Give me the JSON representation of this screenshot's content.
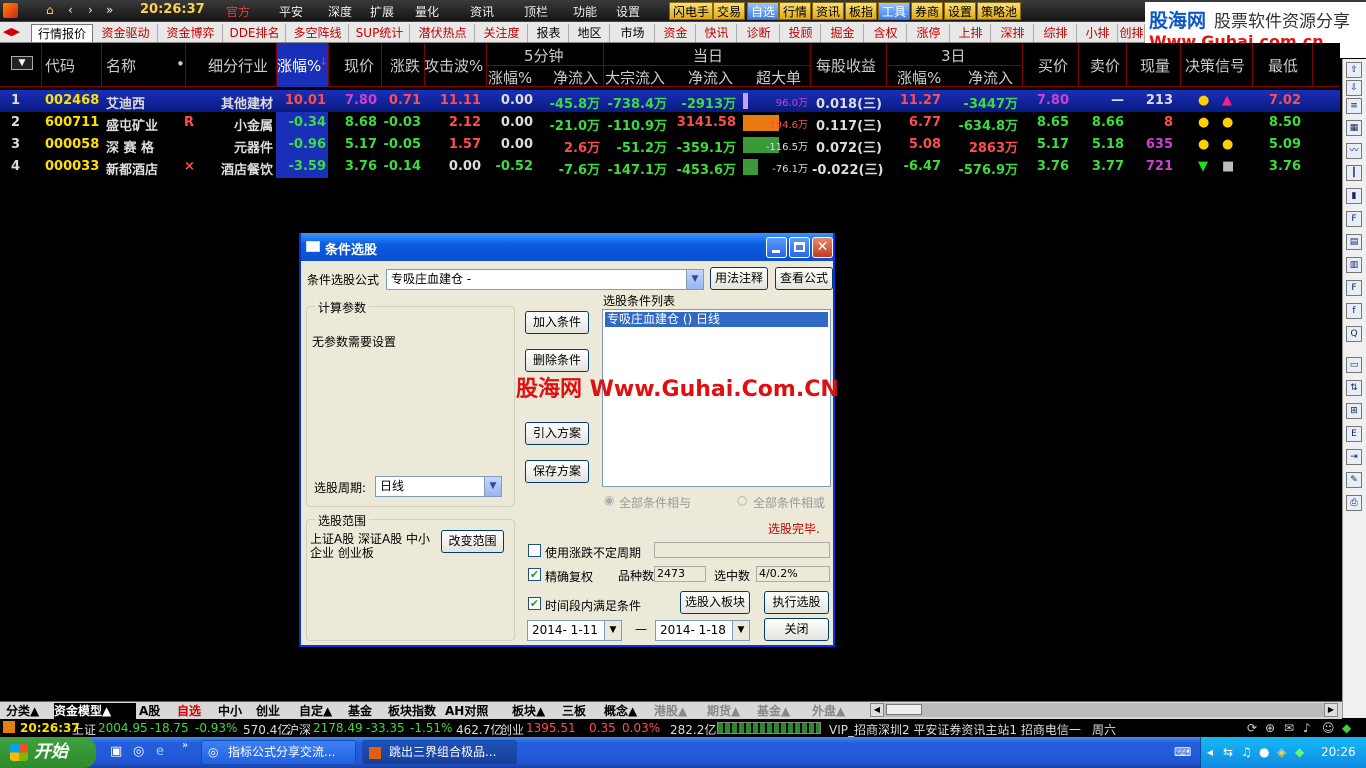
{
  "top_menu": {
    "time": "20:26:37",
    "items": [
      "官方",
      "平安",
      "深度",
      "扩展",
      "量化",
      "资讯",
      "顶栏",
      "功能",
      "设置"
    ],
    "highlight_buttons": [
      "闪电手",
      "交易",
      "自选",
      "行情",
      "资讯",
      "板指",
      "工具",
      "券商",
      "设置",
      "策略池"
    ]
  },
  "watermark": {
    "brand": "股海网",
    "slogan": "股票软件资源分享",
    "url": "Www.Guhai.com.cn"
  },
  "tabs": [
    "行情报价",
    "资金驱动",
    "资金博弈",
    "DDE排名",
    "多空阵线",
    "SUP统计",
    "潜伏热点",
    "关注度",
    "报表",
    "地区",
    "市场",
    "资金",
    "快讯",
    "诊断",
    "投顾",
    "掘金",
    "含权",
    "涨停",
    "上排",
    "深排",
    "综排",
    "小排",
    "创排"
  ],
  "header": {
    "col_code": "代码",
    "col_name": "名称",
    "col_dot": "•",
    "col_industry": "细分行业",
    "col_change": "涨幅%",
    "col_price": "现价",
    "col_updown": "涨跌",
    "col_attack": "攻击波%",
    "group_5min": "5分钟",
    "group_today": "当日",
    "group_3day": "3日",
    "col_5m_change": "涨幅%",
    "col_5m_net": "净流入",
    "col_big_in": "大宗流入",
    "col_today_net": "净流入",
    "col_super": "超大单",
    "col_eps": "每股收益",
    "col_3d_change": "涨幅%",
    "col_3d_net": "净流入",
    "col_bid": "买价",
    "col_ask": "卖价",
    "col_vol": "现量",
    "col_signal": "决策信号",
    "col_low": "最低"
  },
  "rows": [
    {
      "idx": "1",
      "code": "002468",
      "name": "艾迪西",
      "flag": "",
      "industry": "其他建材",
      "change": "10.01",
      "price": "7.80",
      "updown": "0.71",
      "attack": "11.11",
      "m5": "0.00",
      "net5": "-45.8万",
      "bigin": "-738.4万",
      "netday": "-2913万",
      "super": "96.0万",
      "super_pct": 0.08,
      "eps": "0.018(三)",
      "d3": "11.27",
      "net3": "-3447万",
      "bid": "7.80",
      "ask": "—",
      "vol": "213",
      "low": "7.02"
    },
    {
      "idx": "2",
      "code": "600711",
      "name": "盛屯矿业",
      "flag": "R",
      "industry": "小金属",
      "change": "-0.34",
      "price": "8.68",
      "updown": "-0.03",
      "attack": "2.12",
      "m5": "0.00",
      "net5": "-21.0万",
      "bigin": "-110.9万",
      "netday": "3141.58",
      "super": "194.6万",
      "super_pct": 0.6,
      "eps": "0.117(三)",
      "d3": "6.77",
      "net3": "-634.8万",
      "bid": "8.65",
      "ask": "8.66",
      "vol": "8",
      "low": "8.50"
    },
    {
      "idx": "3",
      "code": "000058",
      "name": "深 赛 格",
      "flag": "",
      "industry": "元器件",
      "change": "-0.96",
      "price": "5.17",
      "updown": "-0.05",
      "attack": "1.57",
      "m5": "0.00",
      "net5": "2.6万",
      "bigin": "-51.2万",
      "netday": "-359.1万",
      "super": "-116.5万",
      "super_pct": 0.6,
      "eps": "0.072(三)",
      "d3": "5.08",
      "net3": "2863万",
      "bid": "5.17",
      "ask": "5.18",
      "vol": "635",
      "low": "5.09"
    },
    {
      "idx": "4",
      "code": "000033",
      "name": "新都酒店",
      "flag": "×",
      "industry": "酒店餐饮",
      "change": "-3.59",
      "price": "3.76",
      "updown": "-0.14",
      "attack": "0.00",
      "m5": "-0.52",
      "net5": "-7.6万",
      "bigin": "-147.1万",
      "netday": "-453.6万",
      "super": "-76.1万",
      "super_pct": 0.25,
      "eps": "-0.022(三)",
      "d3": "-6.47",
      "net3": "-576.9万",
      "bid": "3.76",
      "ask": "3.77",
      "vol": "721",
      "low": "3.76"
    }
  ],
  "dialog": {
    "title": "条件选股",
    "formula_label": "条件选股公式",
    "formula_value": "专吸庄血建仓 -",
    "usage_button": "用法注释",
    "view_button": "查看公式",
    "params_group": "计算参数",
    "params_text": "无参数需要设置",
    "period_label": "选股周期:",
    "period_value": "日线",
    "add_button": "加入条件",
    "delete_button": "删除条件",
    "import_button": "引入方案",
    "save_button": "保存方案",
    "list_label": "选股条件列表",
    "list_items": [
      "专吸庄血建仓 () 日线"
    ],
    "radio_and": "全部条件相与",
    "radio_or": "全部条件相或",
    "done_text": "选股完毕.",
    "range_group": "选股范围",
    "range_text": "上证A股 深证A股 中小企业 创业板",
    "change_range_button": "改变范围",
    "chk_period": "使用涨跌不定周期",
    "chk_rights": "精确复权",
    "count_label": "品种数",
    "count_value": "2473",
    "selected_label": "选中数",
    "selected_value": "4/0.2%",
    "chk_timerange": "时间段内满足条件",
    "to_block_button": "选股入板块",
    "run_button": "执行选股",
    "date_from": "2014- 1-11",
    "date_sep": "—",
    "date_to": "2014- 1-18",
    "close_button": "关闭"
  },
  "watermark_center": "股海网 Www.Guhai.Com.CN",
  "bottom_tabs": [
    "分类▲",
    "资金模型▲",
    "A股",
    "自选",
    "中小",
    "创业",
    "自定▲",
    "基金",
    "板块指数",
    "AH对照",
    "板块▲",
    "三板",
    "概念▲",
    "港股▲",
    "期货▲",
    "基金▲",
    "外盘▲"
  ],
  "status": {
    "time": "20:26:37",
    "sh_label": "上证",
    "sh_value": "2004.95",
    "sh_change": "-18.75",
    "sh_pct": "-0.93%",
    "sh_amt": "570.4亿",
    "hs_label": "沪深",
    "hs_value": "2178.49",
    "hs_change": "-33.35",
    "hs_pct": "-1.51%",
    "hs_amt": "462.7亿",
    "cy_label": "创业",
    "cy_value": "1395.51",
    "cy_change": "0.35",
    "cy_pct": "0.03%",
    "cy_amt": "282.2亿",
    "info": "VIP_招商深圳2  平安证券资讯主站1  招商电信一",
    "weekday": "周六"
  },
  "taskbar": {
    "start": "开始",
    "tasks": [
      "指标公式分享交流...",
      "跳出三界组合极品..."
    ],
    "clock": "20:26"
  }
}
